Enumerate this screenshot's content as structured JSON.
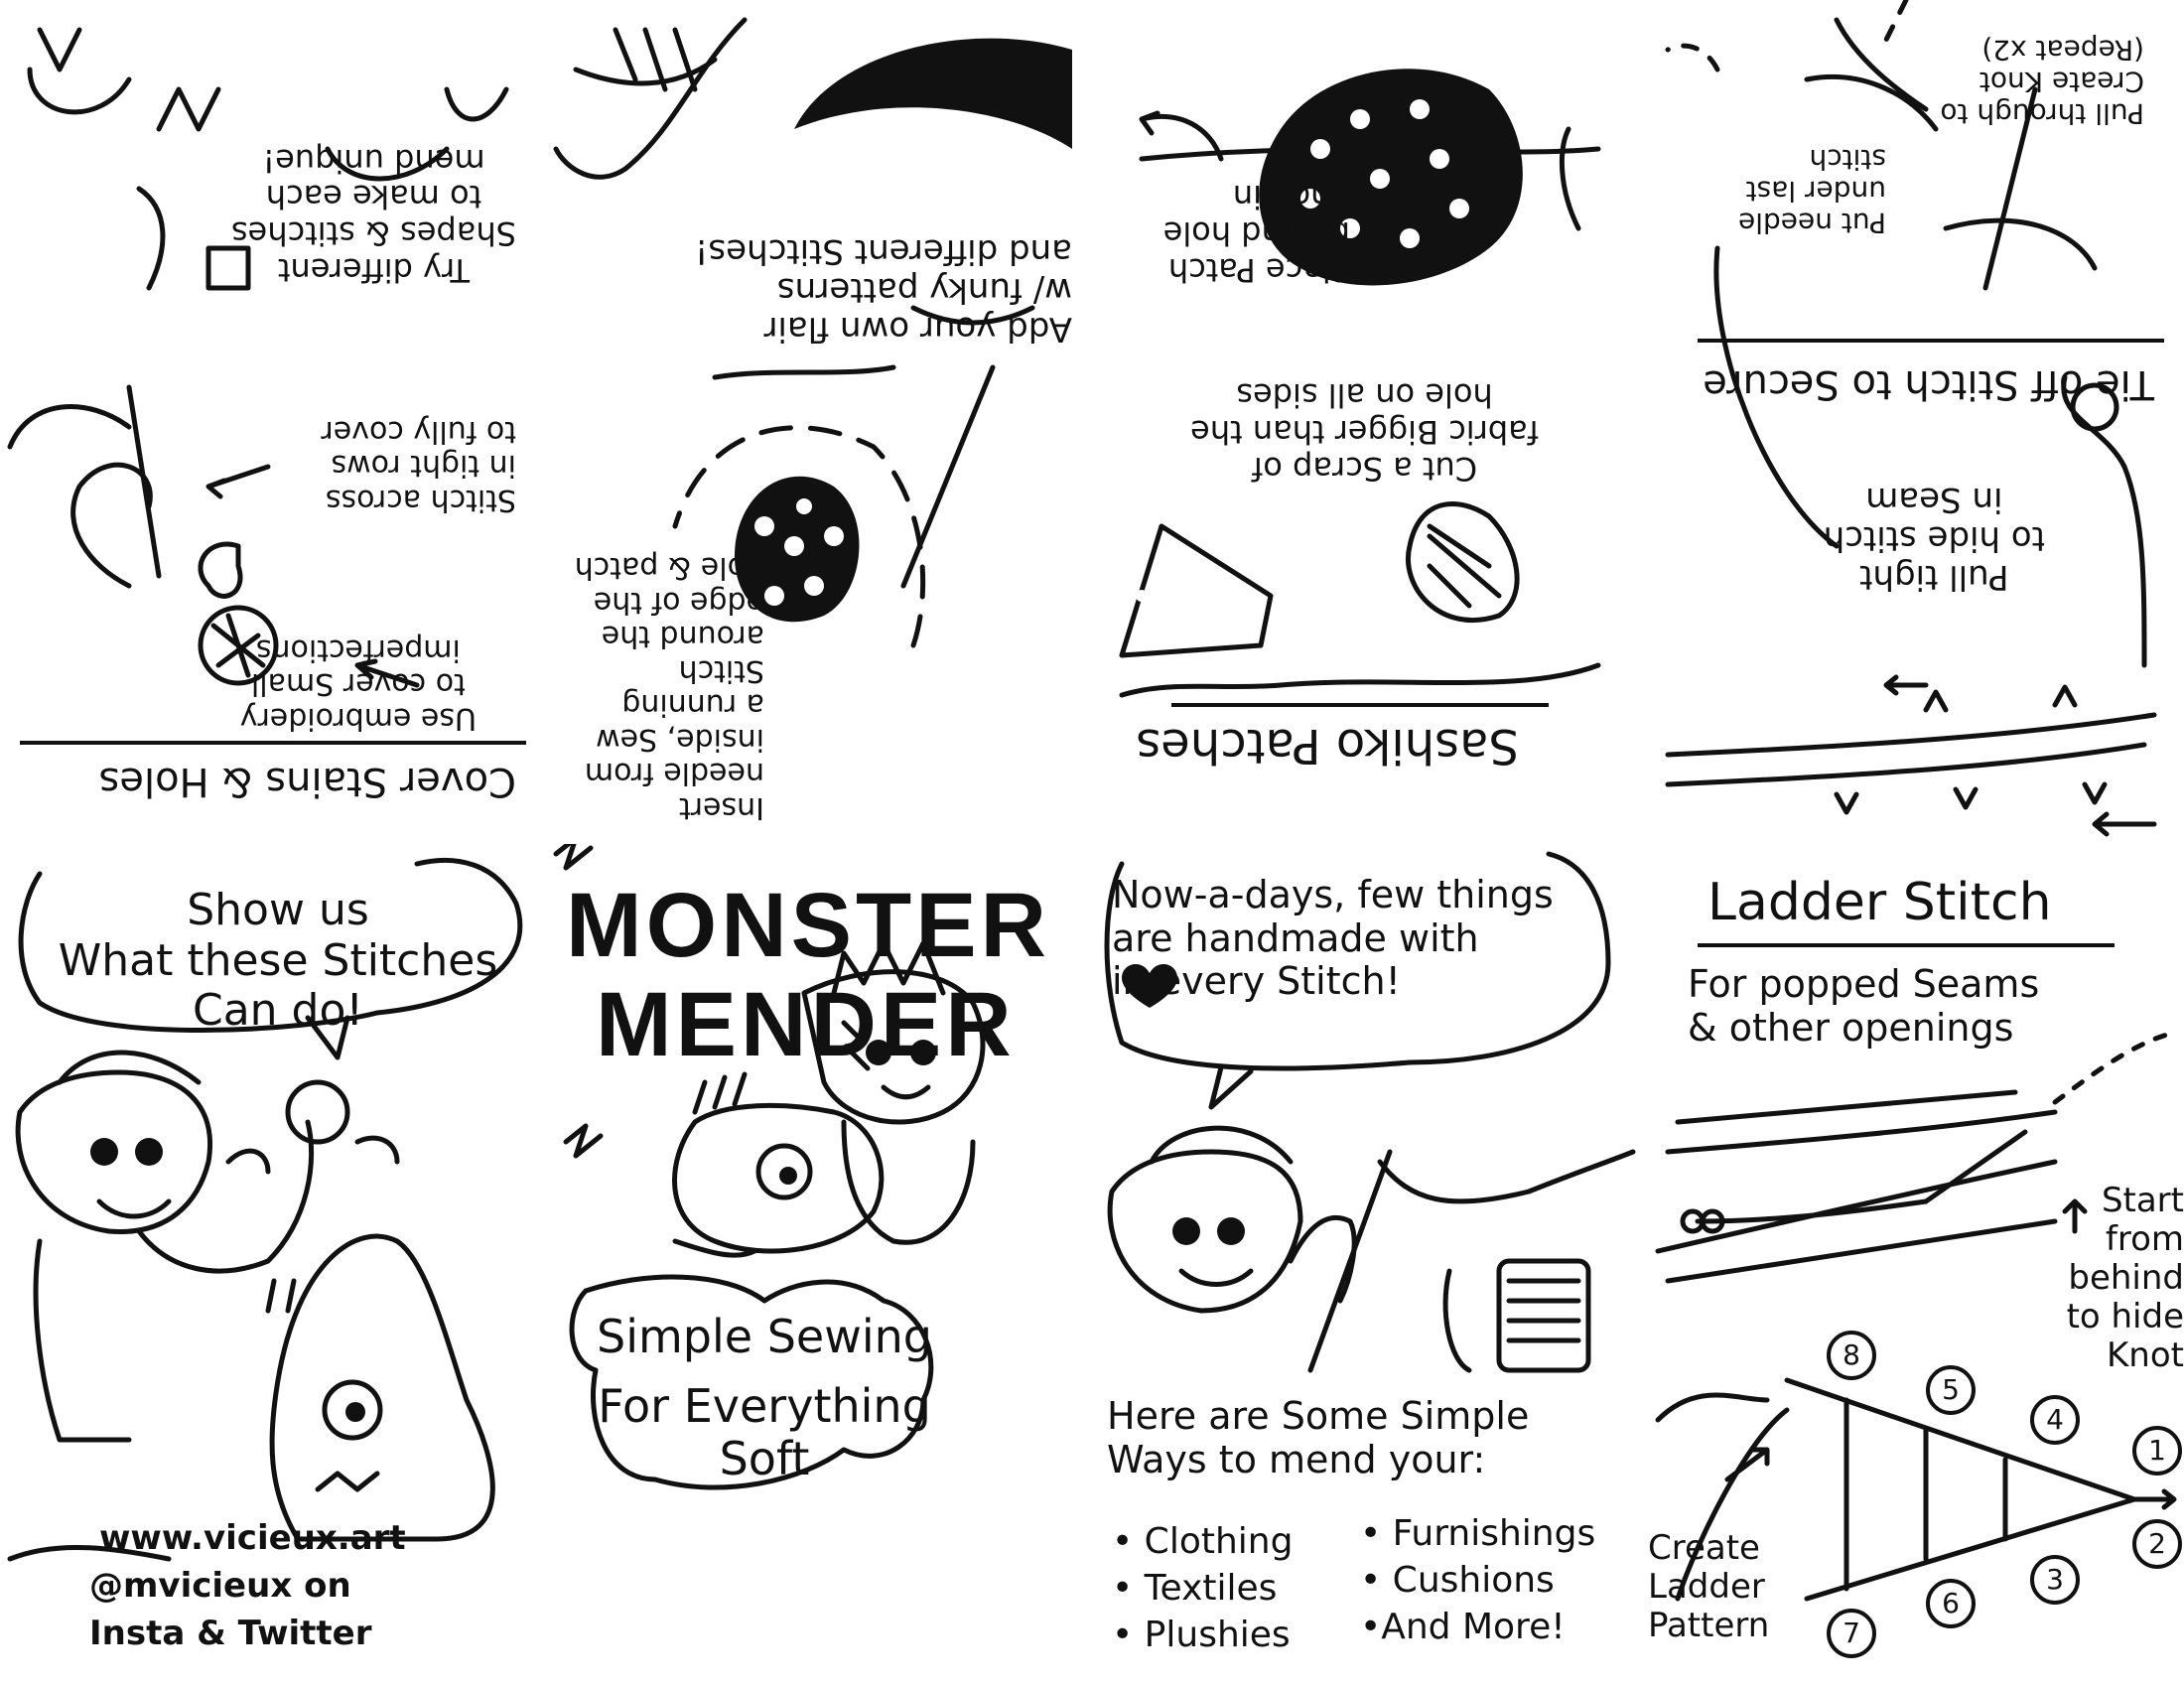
{
  "colors": {
    "ink": "#111111",
    "paper": "#ffffff"
  },
  "cover": {
    "title_line1": "MONSTER",
    "title_line2": "MENDER",
    "subtitle_line1": "Simple Sewing",
    "subtitle_line2": "For Everything Soft"
  },
  "back": {
    "speech": "Show us\nWhat these Stitches\nCan do!",
    "website": "www.vicieux.art",
    "handle": "@mvicieux on",
    "socials": "Insta & Twitter"
  },
  "intro": {
    "speech": "Now-a-days, few things\nare handmade with\nin every Stitch!",
    "heart_icon": "heart-icon",
    "lead": "Here are Some Simple\nWays to mend your:",
    "list_left": [
      "• Clothing",
      "• Textiles",
      "• Plushies"
    ],
    "list_right": [
      "• Furnishings",
      "• Cushions",
      "•And More!"
    ]
  },
  "ladder": {
    "title": "Ladder Stitch",
    "desc": "For popped Seams\n& other openings",
    "start": "Start\nfrom behind\nto hide Knot",
    "create": "Create\nLadder\nPattern",
    "numbers": [
      "1",
      "2",
      "3",
      "4",
      "5",
      "6",
      "7",
      "8"
    ]
  },
  "cover_stains": {
    "title": "Cover Stains & Holes",
    "embroidery": "Use embroidery\nto cover Small\nimperfections",
    "stitch": "Stitch across\nin tight rows\nto fully cover",
    "shapes": "Try different\nShapes & stitches\nto make each\nmend unique!"
  },
  "patch_stitch": {
    "insert": "Insert\nneedle from\ninside, Sew\na running\nStitch\naround the\nedge of the\nhole & patch",
    "flair": "Add your own flair\nw/ funky patterns\nand different Stitches!"
  },
  "sashiko": {
    "title": "Sashiko Patches",
    "scrap": "Cut a Scrap of\nfabric Bigger than the\nhole on all sides",
    "place": "Place Patch\nbehind hole\nand Pin"
  },
  "tie_off": {
    "title": "Tie off Stitch to Secure",
    "pull_hide": "Pull tight\nto hide stitch\nin Seam",
    "put_needle": "Put needle\nunder last\nstitch",
    "pull_through": "Pull through to\nCreate Knot\n(Repeat x2)"
  }
}
